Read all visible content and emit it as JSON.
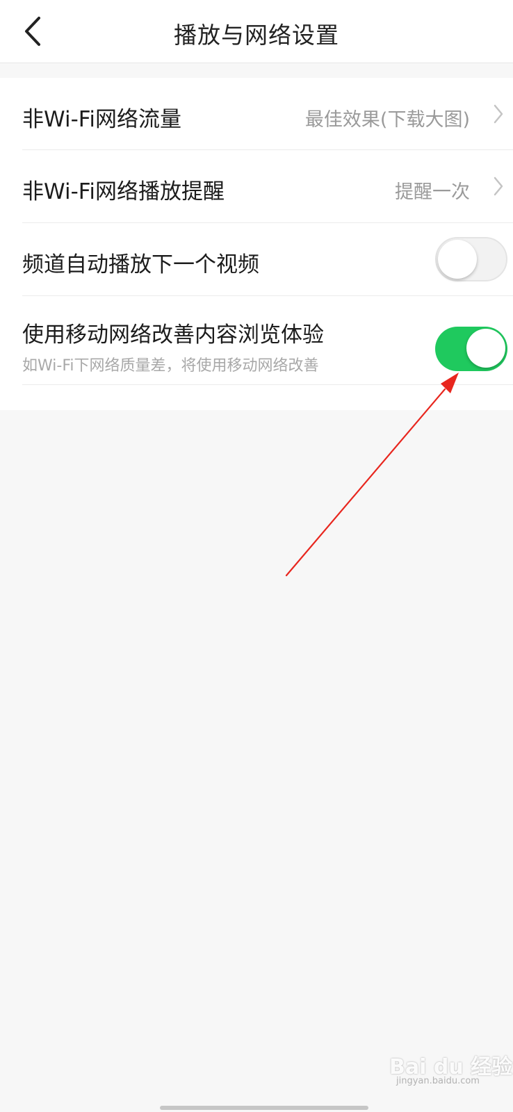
{
  "header": {
    "title": "播放与网络设置",
    "back_icon": "chevron-left-icon"
  },
  "settings": {
    "rows": [
      {
        "label": "非Wi-Fi网络流量",
        "value": "最佳效果(下载大图)",
        "type": "link"
      },
      {
        "label": "非Wi-Fi网络播放提醒",
        "value": "提醒一次",
        "type": "link"
      },
      {
        "label": "频道自动播放下一个视频",
        "type": "toggle",
        "enabled": false
      },
      {
        "label": "使用移动网络改善内容浏览体验",
        "subtitle": "如Wi-Fi下网络质量差，将使用移动网络改善",
        "type": "toggle",
        "enabled": true
      }
    ]
  },
  "annotation": {
    "arrow_color": "#e8261e"
  },
  "colors": {
    "toggle_on": "#1fc95e",
    "background": "#f7f7f7"
  },
  "watermark": {
    "logo": "Bai du 经验",
    "url": "jingyan.baidu.com"
  }
}
